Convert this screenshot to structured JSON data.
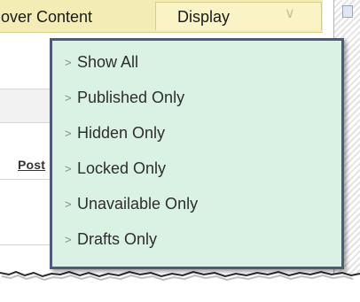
{
  "toolbar": {
    "cover_label": "over Content",
    "display_label": "Display",
    "display_chevron_icon": "double-chevron-down-icon"
  },
  "table": {
    "post_column_header": "Post"
  },
  "menu": {
    "items": [
      {
        "label": "Show All"
      },
      {
        "label": "Published Only"
      },
      {
        "label": "Hidden Only"
      },
      {
        "label": "Locked Only"
      },
      {
        "label": "Unavailable Only"
      },
      {
        "label": "Drafts Only"
      }
    ],
    "item_icon": "chevron-right-icon"
  },
  "colors": {
    "menu_background": "#d9f2e3",
    "menu_border": "#4f5a78",
    "toolbar_background": "#f3ecb4"
  }
}
